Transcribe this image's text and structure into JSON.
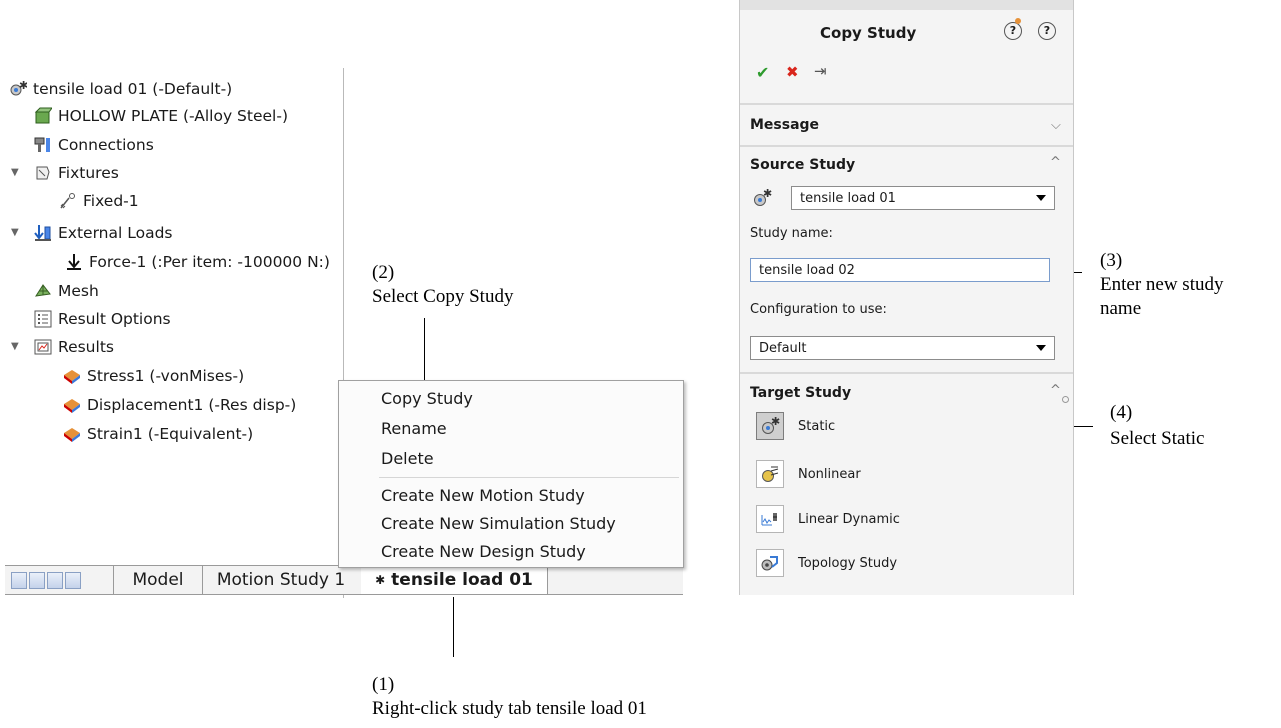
{
  "tree": {
    "root": "tensile load 01 (-Default-)",
    "part": "HOLLOW PLATE (-Alloy Steel-)",
    "connections": "Connections",
    "fixtures": "Fixtures",
    "fixed": "Fixed-1",
    "external_loads": "External Loads",
    "force": "Force-1 (:Per item: -100000 N:)",
    "mesh": "Mesh",
    "result_options": "Result Options",
    "results": "Results",
    "stress": "Stress1 (-vonMises-)",
    "displacement": "Displacement1 (-Res disp-)",
    "strain": "Strain1 (-Equivalent-)"
  },
  "tabs": {
    "model": "Model",
    "motion": "Motion Study 1",
    "study_prefix": "✱",
    "study": "tensile load 01"
  },
  "menu": {
    "copy": "Copy Study",
    "rename": "Rename",
    "delete": "Delete",
    "new_motion": "Create New Motion Study",
    "new_sim": "Create New Simulation Study",
    "new_design": "Create New Design Study"
  },
  "annotations": {
    "a1_num": "(1)",
    "a1_text": "Right-click study tab tensile load 01",
    "a2_num": "(2)",
    "a2_text": "Select Copy Study",
    "a3_num": "(3)",
    "a3_text1": "Enter new study",
    "a3_text2": "name",
    "a4_num": "(4)",
    "a4_text": "Select Static"
  },
  "pm": {
    "title": "Copy Study",
    "icons": {
      "ok": "✔",
      "cancel": "✖",
      "pin": "⇥",
      "help1": "ⓧ",
      "help2": "?"
    },
    "message": "Message",
    "source_study": "Source Study",
    "source_value": "tensile load 01",
    "study_name_label": "Study name:",
    "study_name_value": "tensile load 02",
    "config_label": "Configuration to use:",
    "config_value": "Default",
    "target_study": "Target Study",
    "options": [
      "Static",
      "Nonlinear",
      "Linear Dynamic",
      "Topology Study"
    ]
  },
  "colors": {
    "accent_green": "#2e9b2e",
    "cancel_red": "#d9261c",
    "selected_bg": "#cfcfcf"
  }
}
